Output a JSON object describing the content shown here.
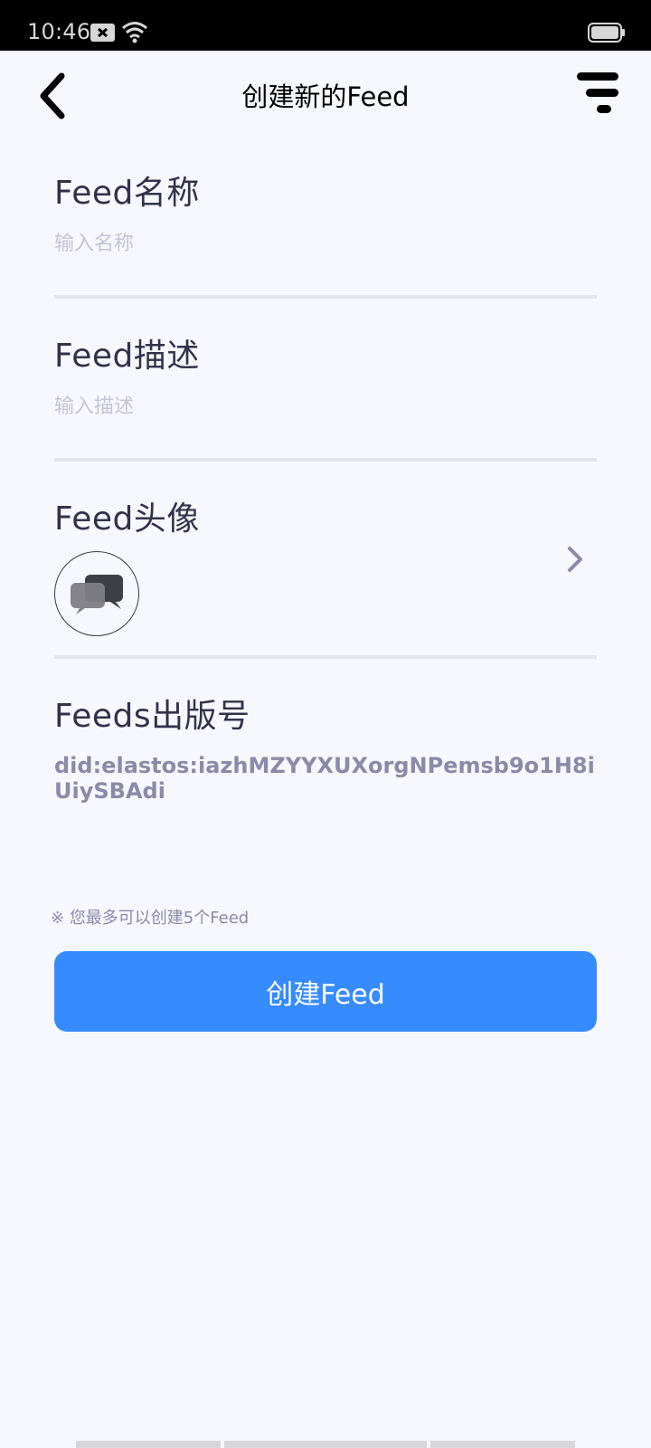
{
  "status_bar": {
    "time": "10:46",
    "icons": [
      "notification-icon",
      "wifi-icon",
      "battery-icon"
    ]
  },
  "header": {
    "title": "创建新的Feed",
    "back_icon": "chevron-left-icon",
    "menu_icon": "menu-icon"
  },
  "form": {
    "name": {
      "label": "Feed名称",
      "placeholder": "输入名称",
      "value": ""
    },
    "description": {
      "label": "Feed描述",
      "placeholder": "输入描述",
      "value": ""
    },
    "avatar": {
      "label": "Feed头像",
      "icon": "chat-bubbles-icon",
      "chevron_icon": "chevron-right-icon"
    },
    "publisher": {
      "label": "Feeds出版号",
      "did": "did:elastos:iazhMZYYXUXorgNPemsb9o1H8iUiySBAdi"
    }
  },
  "note": "※ 您最多可以创建5个Feed",
  "create_button_label": "创建Feed",
  "colors": {
    "accent": "#368bff",
    "text": "#32334a",
    "muted": "#8b8aa8",
    "background": "#f6f8fd"
  }
}
